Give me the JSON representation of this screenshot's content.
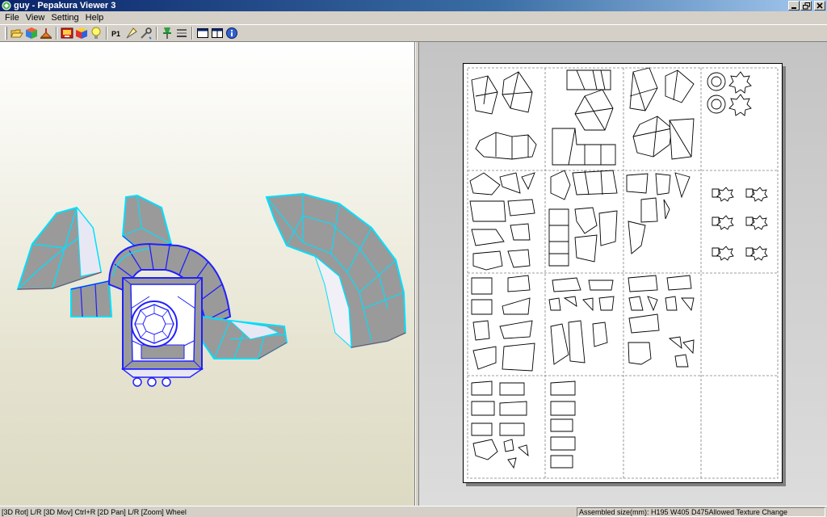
{
  "window": {
    "title": "guy - Pepakura Viewer 3",
    "app_icon": "pepakura-icon",
    "controls": [
      "minimize-icon",
      "maximize-icon",
      "close-icon"
    ]
  },
  "menu": {
    "items": [
      "File",
      "View",
      "Setting",
      "Help"
    ]
  },
  "toolbar": {
    "buttons": [
      {
        "icon": "open-folder-icon"
      },
      {
        "icon": "cube-3d-icon"
      },
      {
        "icon": "print-icon"
      },
      {
        "icon": "texture-icon"
      },
      {
        "icon": "colored-cube-icon"
      },
      {
        "icon": "lightbulb-icon"
      },
      {
        "icon": "page-number-icon",
        "label": "P1"
      },
      {
        "icon": "fold-line-icon"
      },
      {
        "icon": "tools-icon"
      },
      {
        "icon": "pin-icon"
      },
      {
        "icon": "layers-icon"
      },
      {
        "icon": "window-single-icon"
      },
      {
        "icon": "window-split-icon"
      },
      {
        "icon": "info-icon"
      }
    ]
  },
  "colors": {
    "mesh_face": "#9a9a9a",
    "edge_cyan": "#00e0ff",
    "edge_blue": "#2020ff",
    "edge_red": "#e02020",
    "titlebar": "#0a246a"
  },
  "status": {
    "left": "[3D Rot] L/R [3D Mov] Ctrl+R [2D Pan] L/R [Zoom] Wheel",
    "right": "Assembled size(mm): H195 W405 D475Allowed Texture Change"
  }
}
